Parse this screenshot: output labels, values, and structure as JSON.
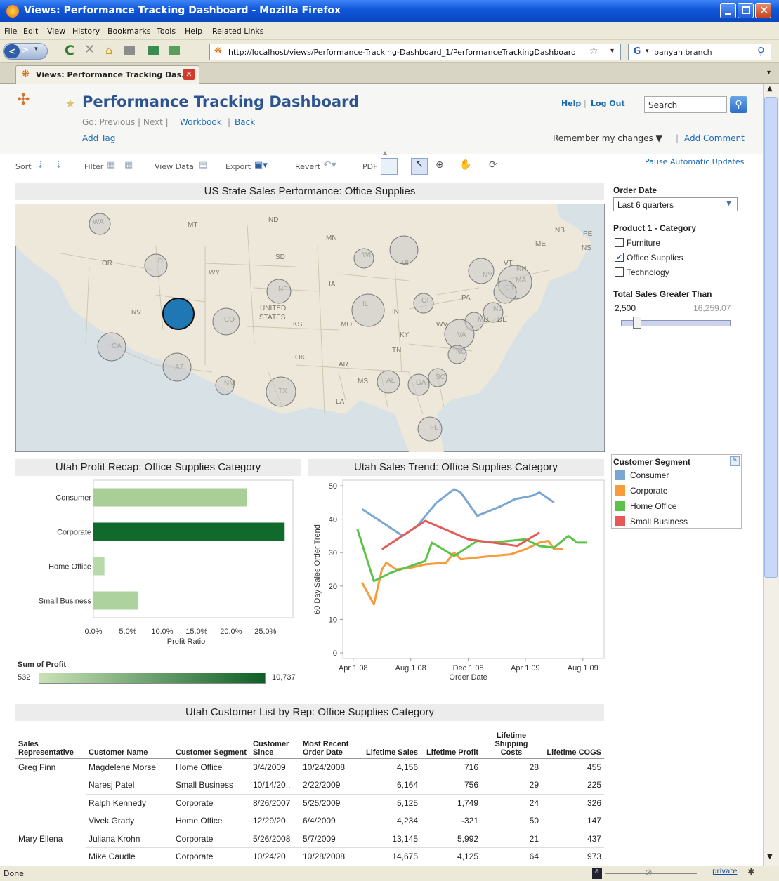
{
  "window": {
    "title": "Views: Performance Tracking Dashboard - Mozilla Firefox"
  },
  "menu": [
    "File",
    "Edit",
    "View",
    "History",
    "Bookmarks",
    "Tools",
    "Help",
    "Related Links"
  ],
  "nav": {
    "url": "http://localhost/views/Performance-Tracking-Dashboard_1/PerformanceTrackingDashboard",
    "search_value": "banyan branch"
  },
  "tab": {
    "label": "Views: Performance Tracking Das..."
  },
  "header": {
    "title": "Performance Tracking Dashboard",
    "go_prefix": "Go: Previous | Next |",
    "workbook": "Workbook",
    "sep": "|",
    "back": "Back",
    "add_tag": "Add Tag",
    "help": "Help",
    "logout": "Log Out",
    "search_placeholder": "Search",
    "remember": "Remember my changes ▼",
    "add_comment": "Add Comment",
    "pause": "Pause Automatic Updates"
  },
  "toolbar": {
    "sort": "Sort",
    "filter": "Filter",
    "view_data": "View Data",
    "export": "Export",
    "revert": "Revert",
    "pdf": "PDF"
  },
  "map": {
    "title": "US State Sales Performance: Office Supplies",
    "state_labels": [
      {
        "t": "WA"
      },
      {
        "t": "MT"
      },
      {
        "t": "ND"
      },
      {
        "t": "MN"
      },
      {
        "t": "SD"
      },
      {
        "t": "OR"
      },
      {
        "t": "ID"
      },
      {
        "t": "WY"
      },
      {
        "t": "NE"
      },
      {
        "t": "IA"
      },
      {
        "t": "WI"
      },
      {
        "t": "MI"
      },
      {
        "t": "NV"
      },
      {
        "t": "UNITED"
      },
      {
        "t": "STATES"
      },
      {
        "t": "KS"
      },
      {
        "t": "CO"
      },
      {
        "t": "MO"
      },
      {
        "t": "IL"
      },
      {
        "t": "IN"
      },
      {
        "t": "OH"
      },
      {
        "t": "PA"
      },
      {
        "t": "NY"
      },
      {
        "t": "VT"
      },
      {
        "t": "NH"
      },
      {
        "t": "MA"
      },
      {
        "t": "CT"
      },
      {
        "t": "NJ"
      },
      {
        "t": "MD"
      },
      {
        "t": "DE"
      },
      {
        "t": "WV"
      },
      {
        "t": "VA"
      },
      {
        "t": "KY"
      },
      {
        "t": "TN"
      },
      {
        "t": "NC"
      },
      {
        "t": "SC"
      },
      {
        "t": "GA"
      },
      {
        "t": "AL"
      },
      {
        "t": "MS"
      },
      {
        "t": "LA"
      },
      {
        "t": "AR"
      },
      {
        "t": "OK"
      },
      {
        "t": "TX"
      },
      {
        "t": "NM"
      },
      {
        "t": "AZ"
      },
      {
        "t": "CA"
      },
      {
        "t": "UT"
      },
      {
        "t": "FL"
      },
      {
        "t": "ME"
      },
      {
        "t": "NB"
      },
      {
        "t": "PE"
      },
      {
        "t": "NS"
      }
    ]
  },
  "filters": {
    "order_date_label": "Order Date",
    "order_date_value": "Last 6 quarters",
    "category_label": "Product 1 - Category",
    "categories": [
      {
        "label": "Furniture",
        "checked": false
      },
      {
        "label": "Office Supplies",
        "checked": true
      },
      {
        "label": "Technology",
        "checked": false
      }
    ],
    "sales_label": "Total Sales Greater Than",
    "sales_min": "2,500",
    "sales_max": "16,259.07",
    "slider_level": 0.12
  },
  "legend": {
    "title": "Customer Segment",
    "items": [
      {
        "label": "Consumer",
        "color": "#7aa6d2"
      },
      {
        "label": "Corporate",
        "color": "#f89b3c"
      },
      {
        "label": "Home Office",
        "color": "#5cc24a"
      },
      {
        "label": "Small Business",
        "color": "#e55a57"
      }
    ]
  },
  "profit_chart_title": "Utah Profit Recap: Office Supplies Category",
  "trend_chart_title": "Utah Sales Trend: Office Supplies Category",
  "color_scale": {
    "label": "Sum of Profit",
    "min": "532",
    "max": "10,737"
  },
  "chart_data": [
    {
      "type": "bar",
      "title": "Utah Profit Recap: Office Supplies Category",
      "categories": [
        "Consumer",
        "Corporate",
        "Home Office",
        "Small Business"
      ],
      "values": [
        0.223,
        0.278,
        0.016,
        0.065
      ],
      "colors": [
        "#a9cf97",
        "#0f6a2c",
        "#b8d9a9",
        "#aed29d"
      ],
      "xlabel": "Profit Ratio",
      "xticks": [
        "0.0%",
        "5.0%",
        "10.0%",
        "15.0%",
        "20.0%",
        "25.0%"
      ],
      "xlim": [
        0,
        0.29
      ]
    },
    {
      "type": "line",
      "title": "Utah Sales Trend: Office Supplies Category",
      "xlabel": "Order Date",
      "ylabel": "60 Day Sales Order Trend",
      "ylim": [
        0,
        50
      ],
      "yticks": [
        "0",
        "10",
        "20",
        "30",
        "40",
        "50"
      ],
      "xticks": [
        {
          "label": "Apr 1 08",
          "date": "2008-04-01"
        },
        {
          "label": "Aug 1 08",
          "date": "2008-08-01"
        },
        {
          "label": "Dec 1 08",
          "date": "2008-12-01"
        },
        {
          "label": "Apr 1 09",
          "date": "2009-04-01"
        },
        {
          "label": "Aug 1 09",
          "date": "2009-08-01"
        }
      ],
      "series": [
        {
          "name": "Consumer",
          "color": "#7aa6d2",
          "points": [
            [
              "2008-04-20",
              43
            ],
            [
              "2008-07-15",
              35
            ],
            [
              "2008-08-15",
              38
            ],
            [
              "2008-09-25",
              45
            ],
            [
              "2008-11-01",
              49
            ],
            [
              "2008-11-15",
              48
            ],
            [
              "2008-12-20",
              41
            ],
            [
              "2009-02-10",
              44
            ],
            [
              "2009-03-10",
              46
            ],
            [
              "2009-04-15",
              47
            ],
            [
              "2009-05-01",
              48
            ],
            [
              "2009-06-01",
              45
            ]
          ]
        },
        {
          "name": "Corporate",
          "color": "#f89b3c",
          "points": [
            [
              "2008-04-20",
              21
            ],
            [
              "2008-05-15",
              14.5
            ],
            [
              "2008-06-01",
              25
            ],
            [
              "2008-06-10",
              27
            ],
            [
              "2008-07-01",
              25
            ],
            [
              "2008-08-01",
              25.5
            ],
            [
              "2008-09-01",
              26.5
            ],
            [
              "2008-10-15",
              27
            ],
            [
              "2008-11-01",
              30
            ],
            [
              "2008-11-15",
              28
            ],
            [
              "2009-01-20",
              29
            ],
            [
              "2009-03-01",
              29.5
            ],
            [
              "2009-04-01",
              31
            ],
            [
              "2009-05-01",
              33
            ],
            [
              "2009-05-20",
              33.5
            ],
            [
              "2009-06-01",
              31
            ],
            [
              "2009-06-20",
              31
            ]
          ]
        },
        {
          "name": "Home Office",
          "color": "#5cc24a",
          "points": [
            [
              "2008-04-10",
              37
            ],
            [
              "2008-05-15",
              21.5
            ],
            [
              "2008-06-20",
              24
            ],
            [
              "2008-09-01",
              27.5
            ],
            [
              "2008-09-15",
              33
            ],
            [
              "2008-11-01",
              29
            ],
            [
              "2008-12-20",
              33.5
            ],
            [
              "2009-01-20",
              33
            ],
            [
              "2009-04-01",
              34
            ],
            [
              "2009-05-01",
              32
            ],
            [
              "2009-06-01",
              31.5
            ],
            [
              "2009-07-01",
              35
            ],
            [
              "2009-07-20",
              33
            ],
            [
              "2009-08-10",
              33
            ]
          ]
        },
        {
          "name": "Small Business",
          "color": "#e55a57",
          "points": [
            [
              "2008-06-01",
              31
            ],
            [
              "2008-09-01",
              39.5
            ],
            [
              "2008-12-01",
              34
            ],
            [
              "2009-03-15",
              32
            ],
            [
              "2009-05-01",
              36
            ]
          ]
        }
      ]
    }
  ],
  "customer_table": {
    "title": "Utah Customer List by Rep: Office Supplies Category",
    "columns": [
      "Sales Representative",
      "Customer Name",
      "Customer Segment",
      "Customer Since",
      "Most Recent Order Date",
      "Lifetime Sales",
      "Lifetime Profit",
      "Lifetime Shipping Costs",
      "Lifetime COGS"
    ],
    "rows": [
      [
        "Greg Finn",
        "Magdelene Morse",
        "Home Office",
        "3/4/2009",
        "10/24/2008",
        "4,156",
        "716",
        "28",
        "455"
      ],
      [
        "",
        "Naresj Patel",
        "Small Business",
        "10/14/20..",
        "2/22/2009",
        "6,164",
        "756",
        "29",
        "225"
      ],
      [
        "",
        "Ralph Kennedy",
        "Corporate",
        "8/26/2007",
        "5/25/2009",
        "5,125",
        "1,749",
        "24",
        "326"
      ],
      [
        "",
        "Vivek Grady",
        "Home Office",
        "12/29/20..",
        "6/4/2009",
        "4,234",
        "-321",
        "50",
        "147"
      ],
      [
        "Mary Ellena",
        "Juliana Krohn",
        "Corporate",
        "5/26/2008",
        "5/7/2009",
        "13,145",
        "5,992",
        "21",
        "437"
      ],
      [
        "",
        "Mike Caudle",
        "Corporate",
        "10/24/20..",
        "10/28/2008",
        "14,675",
        "4,125",
        "64",
        "973"
      ]
    ]
  },
  "status": {
    "text": "Done",
    "private": "private"
  }
}
